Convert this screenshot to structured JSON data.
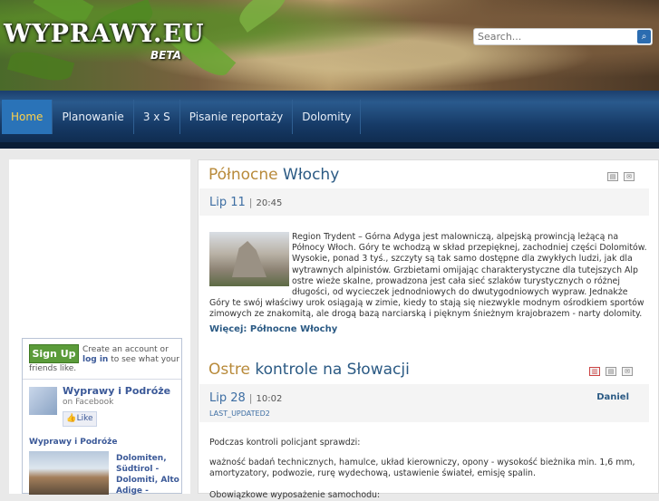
{
  "header": {
    "logo": "WYPRAWY.EU",
    "beta": "BETA",
    "search_placeholder": "Search..."
  },
  "nav": {
    "items": [
      {
        "label": "Home",
        "active": true
      },
      {
        "label": "Planowanie",
        "active": false
      },
      {
        "label": "3 x S",
        "active": false
      },
      {
        "label": "Pisanie reportaży",
        "active": false
      },
      {
        "label": "Dolomity",
        "active": false
      }
    ]
  },
  "facebook": {
    "signup_label": "Sign Up",
    "text_before": "Create an account or",
    "login_label": "log in",
    "text_after": "to see what your",
    "text_line2": "friends like.",
    "page_name": "Wyprawy i Podróże",
    "on_facebook": "on Facebook",
    "like_label": "Like",
    "page_name_small": "Wyprawy i Podróże",
    "post_title": "Dolomiten, Südtirol - Dolomiti, Alto Adige -"
  },
  "articles": [
    {
      "title_first": "Północne",
      "title_rest": " Włochy",
      "date": "Lip 11",
      "time": "20:45",
      "body": "Region Trydent – Górna Adyga jest malowniczą, alpejską prowincją leżącą na Północy Włoch. Góry te wchodzą w skład przepięknej, zachodniej części Dolomitów. Wysokie, ponad 3 tyś., szczyty są tak samo dostępne dla zwykłych ludzi, jak dla wytrawnych alpinistów. Grzbietami omijając charakterystyczne dla tutejszych Alp ostre wieże skalne, prowadzona jest cała sieć szlaków turystycznych o różnej długości, od wycieczek jednodniowych do dwutygodniowych wypraw. Jednakże Góry te swój właściwy urok osiągają w zimie, kiedy to stają się niezwykle modnym ośrodkiem sportów zimowych ze znakomitą, ale drogą bazą narciarską i pięknym śnieżnym krajobrazem - narty dolomity.",
      "more_label": "Więcej: Północne Włochy"
    },
    {
      "title_first": "Ostre",
      "title_rest": " kontrole na Słowacji",
      "date": "Lip 28",
      "time": "10:02",
      "author": "Daniel",
      "updated": "LAST_UPDATED2",
      "para1": "Podczas kontroli policjant sprawdzi:",
      "para2": "ważność badań technicznych, hamulce, układ kierowniczy, opony - wysokość bieżnika min. 1,6 mm, amortyzatory, podwozie, rurę wydechową, ustawienie świateł, emisję spalin.",
      "para3": "Obowiązkowe wyposażenie samochodu:"
    }
  ],
  "colors": {
    "nav_bg": "#1b3f6d",
    "nav_active": "#2a73b8",
    "nav_active_text": "#ffd24a",
    "title_accent": "#b88a3a",
    "link": "#2b5a84"
  }
}
